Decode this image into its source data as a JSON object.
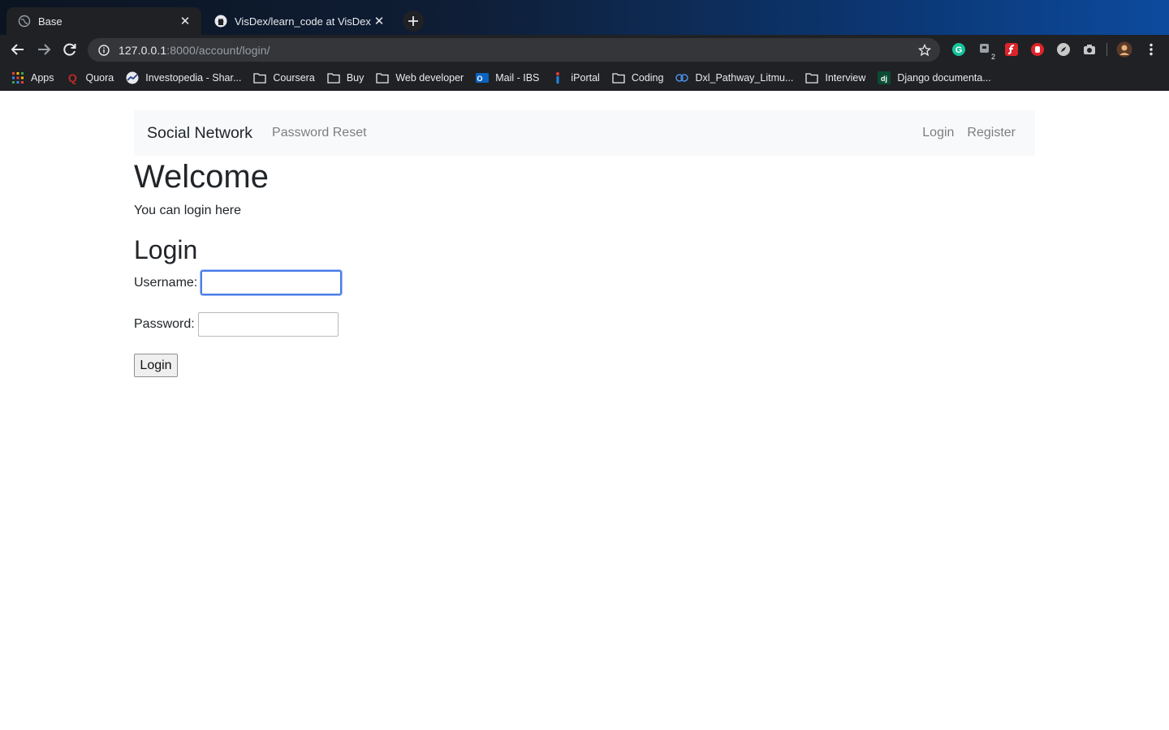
{
  "browser": {
    "tabs": [
      {
        "title": "Base",
        "icon": "globe-icon",
        "active": true
      },
      {
        "title": "VisDex/learn_code at VisDex",
        "icon": "github-icon",
        "active": false
      }
    ],
    "address": {
      "host": "127.0.0.1",
      "path": ":8000/account/login/"
    },
    "bookmarks": [
      {
        "label": "Apps",
        "icon": "apps-grid-icon"
      },
      {
        "label": "Quora",
        "icon": "quora-icon"
      },
      {
        "label": "Investopedia - Shar...",
        "icon": "investopedia-icon"
      },
      {
        "label": "Coursera",
        "icon": "folder-icon"
      },
      {
        "label": "Buy",
        "icon": "folder-icon"
      },
      {
        "label": "Web developer",
        "icon": "folder-icon"
      },
      {
        "label": "Mail - IBS",
        "icon": "outlook-icon"
      },
      {
        "label": "iPortal",
        "icon": "iportal-icon"
      },
      {
        "label": "Coding",
        "icon": "folder-icon"
      },
      {
        "label": "Dxl_Pathway_Litmu...",
        "icon": "litmus-icon"
      },
      {
        "label": "Interview",
        "icon": "folder-icon"
      },
      {
        "label": "Django documenta...",
        "icon": "django-icon"
      }
    ],
    "extension_badge": "2",
    "colors": {
      "focus_ring": "#4a7be8",
      "grammarly": "#15c39a",
      "navbar_bg": "#f8f9fa"
    }
  },
  "navbar": {
    "brand": "Social Network",
    "left_links": [
      "Password Reset"
    ],
    "right_links": [
      "Login",
      "Register"
    ]
  },
  "main": {
    "heading": "Welcome",
    "subtitle": "You can login here",
    "form_title": "Login",
    "username_label": "Username:",
    "username_value": "",
    "password_label": "Password:",
    "password_value": "",
    "submit_label": "Login"
  }
}
